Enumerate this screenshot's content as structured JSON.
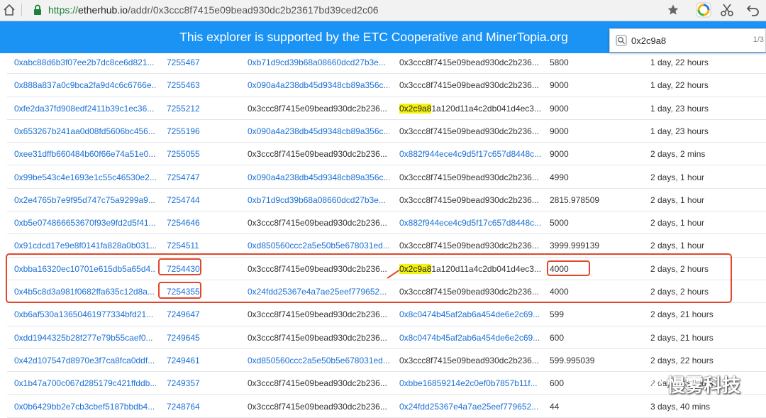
{
  "browser": {
    "url_scheme": "https://",
    "url_host": "etherhub.io",
    "url_path": "/addr/0x3ccc8f7415e09bead930dc2b23617bd39ced2c06"
  },
  "banner": {
    "text": "This explorer is supported by the ETC Cooperative and MinerTopia.org"
  },
  "find": {
    "query": "0x2c9a8",
    "count": "1/3"
  },
  "watermark": {
    "text": "慢雾科技"
  },
  "colors": {
    "banner": "#1b93f5",
    "link": "#1a6fd6",
    "highlight": "#f5f20d",
    "annotation": "#e0472c"
  },
  "rows": [
    {
      "hash": "0xabc88d6b3f07ee2b7dc8ce6d821...",
      "block": "7255467",
      "from": "0xb71d9cd39b68a08660dcd27b3e...",
      "from_link": true,
      "to_hl": "",
      "to": "0x3ccc8f7415e09bead930dc2b236...",
      "to_link": false,
      "value": "5800",
      "age": "1 day, 22 hours"
    },
    {
      "hash": "0x888a837a0c9bca2fa9d4c6c6766e...",
      "block": "7255463",
      "from": "0x090a4a238db45d9348cb89a356c...",
      "from_link": true,
      "to_hl": "",
      "to": "0x3ccc8f7415e09bead930dc2b236...",
      "to_link": false,
      "value": "9000",
      "age": "1 day, 22 hours"
    },
    {
      "hash": "0xfe2da37fd908edf2411b39c1ec36...",
      "block": "7255212",
      "from": "0x3ccc8f7415e09bead930dc2b236...",
      "from_link": false,
      "to_hl": "0x2c9a8",
      "to": "1a120d11a4c2db041d4ec3...",
      "to_link": false,
      "value": "9000",
      "age": "1 day, 23 hours"
    },
    {
      "hash": "0x653267b241aa0d08fd5606bc456...",
      "block": "7255196",
      "from": "0x090a4a238db45d9348cb89a356c...",
      "from_link": true,
      "to_hl": "",
      "to": "0x3ccc8f7415e09bead930dc2b236...",
      "to_link": false,
      "value": "9000",
      "age": "1 day, 23 hours"
    },
    {
      "hash": "0xee31dffb660484b60f66e74a51e0...",
      "block": "7255055",
      "from": "0x3ccc8f7415e09bead930dc2b236...",
      "from_link": false,
      "to_hl": "",
      "to": "0x882f944ece4c9d5f17c657d8448c...",
      "to_link": true,
      "value": "9000",
      "age": "2 days, 2 mins"
    },
    {
      "hash": "0x99be543c4e1693e1c55c46530e2...",
      "block": "7254747",
      "from": "0x090a4a238db45d9348cb89a356c...",
      "from_link": true,
      "to_hl": "",
      "to": "0x3ccc8f7415e09bead930dc2b236...",
      "to_link": false,
      "value": "4990",
      "age": "2 days, 1 hour"
    },
    {
      "hash": "0x2e4765b7e9f95d747c75a9299a9...",
      "block": "7254744",
      "from": "0xb71d9cd39b68a08660dcd27b3e...",
      "from_link": true,
      "to_hl": "",
      "to": "0x3ccc8f7415e09bead930dc2b236...",
      "to_link": false,
      "value": "2815.978509",
      "age": "2 days, 1 hour"
    },
    {
      "hash": "0xb5e074866653670f93e9fd2d5f41...",
      "block": "7254646",
      "from": "0x3ccc8f7415e09bead930dc2b236...",
      "from_link": false,
      "to_hl": "",
      "to": "0x882f944ece4c9d5f17c657d8448c...",
      "to_link": true,
      "value": "5000",
      "age": "2 days, 1 hour"
    },
    {
      "hash": "0x91cdcd17e9e8f0141fa828a0b031...",
      "block": "7254511",
      "from": "0xd850560ccc2a5e50b5e678031ed...",
      "from_link": true,
      "to_hl": "",
      "to": "0x3ccc8f7415e09bead930dc2b236...",
      "to_link": false,
      "value": "3999.999139",
      "age": "2 days, 1 hour"
    },
    {
      "hash": "0xbba16320ec10701e615db5a65d4...",
      "block": "7254430",
      "from": "0x3ccc8f7415e09bead930dc2b236...",
      "from_link": false,
      "to_hl": "0x2c9a8",
      "to": "1a120d11a4c2db041d4ec3...",
      "to_link": false,
      "value": "4000",
      "age": "2 days, 2 hours"
    },
    {
      "hash": "0x4b5c8d3a981f0682ffa635c12d8a...",
      "block": "7254355",
      "from": "0x24fdd25367e4a7ae25eef779652...",
      "from_link": true,
      "to_hl": "",
      "to": "0x3ccc8f7415e09bead930dc2b236...",
      "to_link": false,
      "value": "4000",
      "age": "2 days, 2 hours"
    },
    {
      "hash": "0xb6af530a13650461977334bfd21...",
      "block": "7249647",
      "from": "0x3ccc8f7415e09bead930dc2b236...",
      "from_link": false,
      "to_hl": "",
      "to": "0x8c0474b45af2ab6a454de6e2c69...",
      "to_link": true,
      "value": "599",
      "age": "2 days, 21 hours"
    },
    {
      "hash": "0xdd1944325b28f277e79b55caef0...",
      "block": "7249645",
      "from": "0x3ccc8f7415e09bead930dc2b236...",
      "from_link": false,
      "to_hl": "",
      "to": "0x8c0474b45af2ab6a454de6e2c69...",
      "to_link": true,
      "value": "600",
      "age": "2 days, 21 hours"
    },
    {
      "hash": "0x42d107547d8970e3f7ca8fca0ddf...",
      "block": "7249461",
      "from": "0xd850560ccc2a5e50b5e678031ed...",
      "from_link": true,
      "to_hl": "",
      "to": "0x3ccc8f7415e09bead930dc2b236...",
      "to_link": false,
      "value": "599.995039",
      "age": "2 days, 22 hours"
    },
    {
      "hash": "0x1b47a700c067d285179c421ffddb...",
      "block": "7249357",
      "from": "0x3ccc8f7415e09bead930dc2b236...",
      "from_link": false,
      "to_hl": "",
      "to": "0xbbe16859214e2c0ef0b7857b11f...",
      "to_link": true,
      "value": "600",
      "age": "2 days, 23 hours"
    },
    {
      "hash": "0x0b6429bb2e7cb3cbef5187bbdb4...",
      "block": "7248764",
      "from": "0x3ccc8f7415e09bead930dc2b236...",
      "from_link": false,
      "to_hl": "",
      "to": "0x24fdd25367e4a7ae25eef779652...",
      "to_link": true,
      "value": "44",
      "age": "3 days, 40 mins"
    }
  ]
}
